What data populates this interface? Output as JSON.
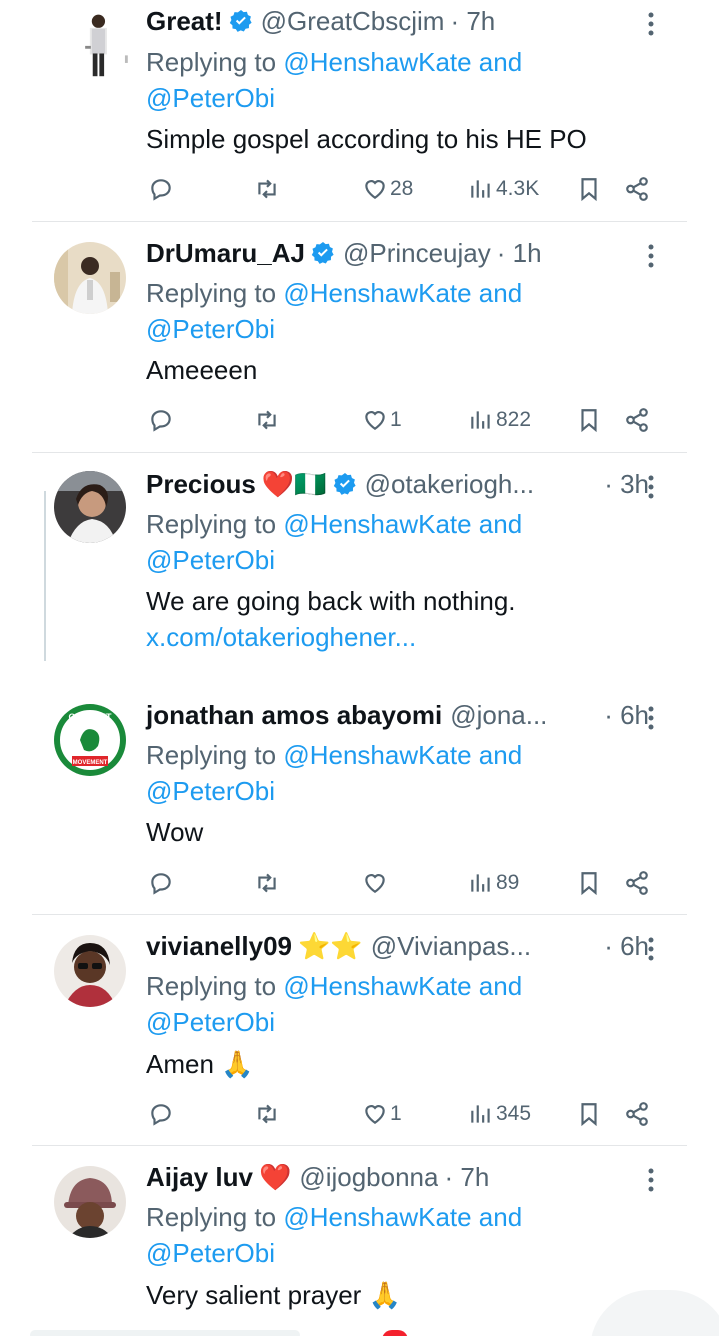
{
  "tweets": [
    {
      "name": "Great!",
      "verified": true,
      "emoji": "",
      "handle": "@GreatCbscjim",
      "time": "· 7h",
      "replying_prefix": "Replying to",
      "replying_to_1": "@HenshawKate and",
      "replying_to_2": "@PeterObi",
      "text": "Simple gospel according to his HE PO",
      "link": "",
      "reply_count": "",
      "retweet_count": "",
      "like_count": "28",
      "view_count": "4.3K"
    },
    {
      "name": "DrUmaru_AJ",
      "verified": true,
      "emoji": "",
      "handle": "@Princeujay",
      "time": "· 1h",
      "replying_prefix": "Replying to",
      "replying_to_1": "@HenshawKate and",
      "replying_to_2": "@PeterObi",
      "text": "Ameeeen",
      "link": "",
      "reply_count": "",
      "retweet_count": "",
      "like_count": "1",
      "view_count": "822"
    },
    {
      "name": "Precious",
      "verified": true,
      "emoji": "❤️🇳🇬",
      "handle": "@otakeriogh...",
      "time": "· 3h",
      "replying_prefix": "Replying to",
      "replying_to_1": "@HenshawKate and",
      "replying_to_2": "@PeterObi",
      "text": "We are going back with nothing.",
      "link": "x.com/otakerioghener...",
      "reply_count": "",
      "retweet_count": "",
      "like_count": "",
      "view_count": ""
    },
    {
      "name": "jonathan amos abayomi",
      "verified": false,
      "emoji": "",
      "handle": "@jona...",
      "time": "· 6h",
      "replying_prefix": "Replying to",
      "replying_to_1": "@HenshawKate and",
      "replying_to_2": "@PeterObi",
      "text": "Wow",
      "link": "",
      "reply_count": "",
      "retweet_count": "",
      "like_count": "",
      "view_count": "89",
      "avatar_text_top": "OBIDIENT",
      "avatar_text_bottom": "MOVEMENT"
    },
    {
      "name": "vivianelly09",
      "verified": false,
      "emoji": "⭐⭐",
      "handle": "@Vivianpas...",
      "time": "· 6h",
      "replying_prefix": "Replying to",
      "replying_to_1": "@HenshawKate and",
      "replying_to_2": "@PeterObi",
      "text": "Amen 🙏",
      "link": "",
      "reply_count": "",
      "retweet_count": "",
      "like_count": "1",
      "view_count": "345"
    },
    {
      "name": "Aijay luv",
      "verified": false,
      "emoji": "❤️",
      "handle": "@ijogbonna",
      "time": "· 7h",
      "replying_prefix": "Replying to",
      "replying_to_1": "@HenshawKate and",
      "replying_to_2": "@PeterObi",
      "text": "Very salient prayer 🙏",
      "link": ""
    }
  ],
  "colors": {
    "text": "#0f1419",
    "secondary": "#536471",
    "link": "#1d9bf0",
    "verified": "#1d9bf0",
    "divider": "#e4e6e8"
  },
  "icons": {
    "reply": "reply-icon",
    "retweet": "retweet-icon",
    "like": "heart-icon",
    "views": "views-icon",
    "bookmark": "bookmark-icon",
    "share": "share-icon",
    "more": "more-icon",
    "verified": "verified-badge-icon"
  }
}
